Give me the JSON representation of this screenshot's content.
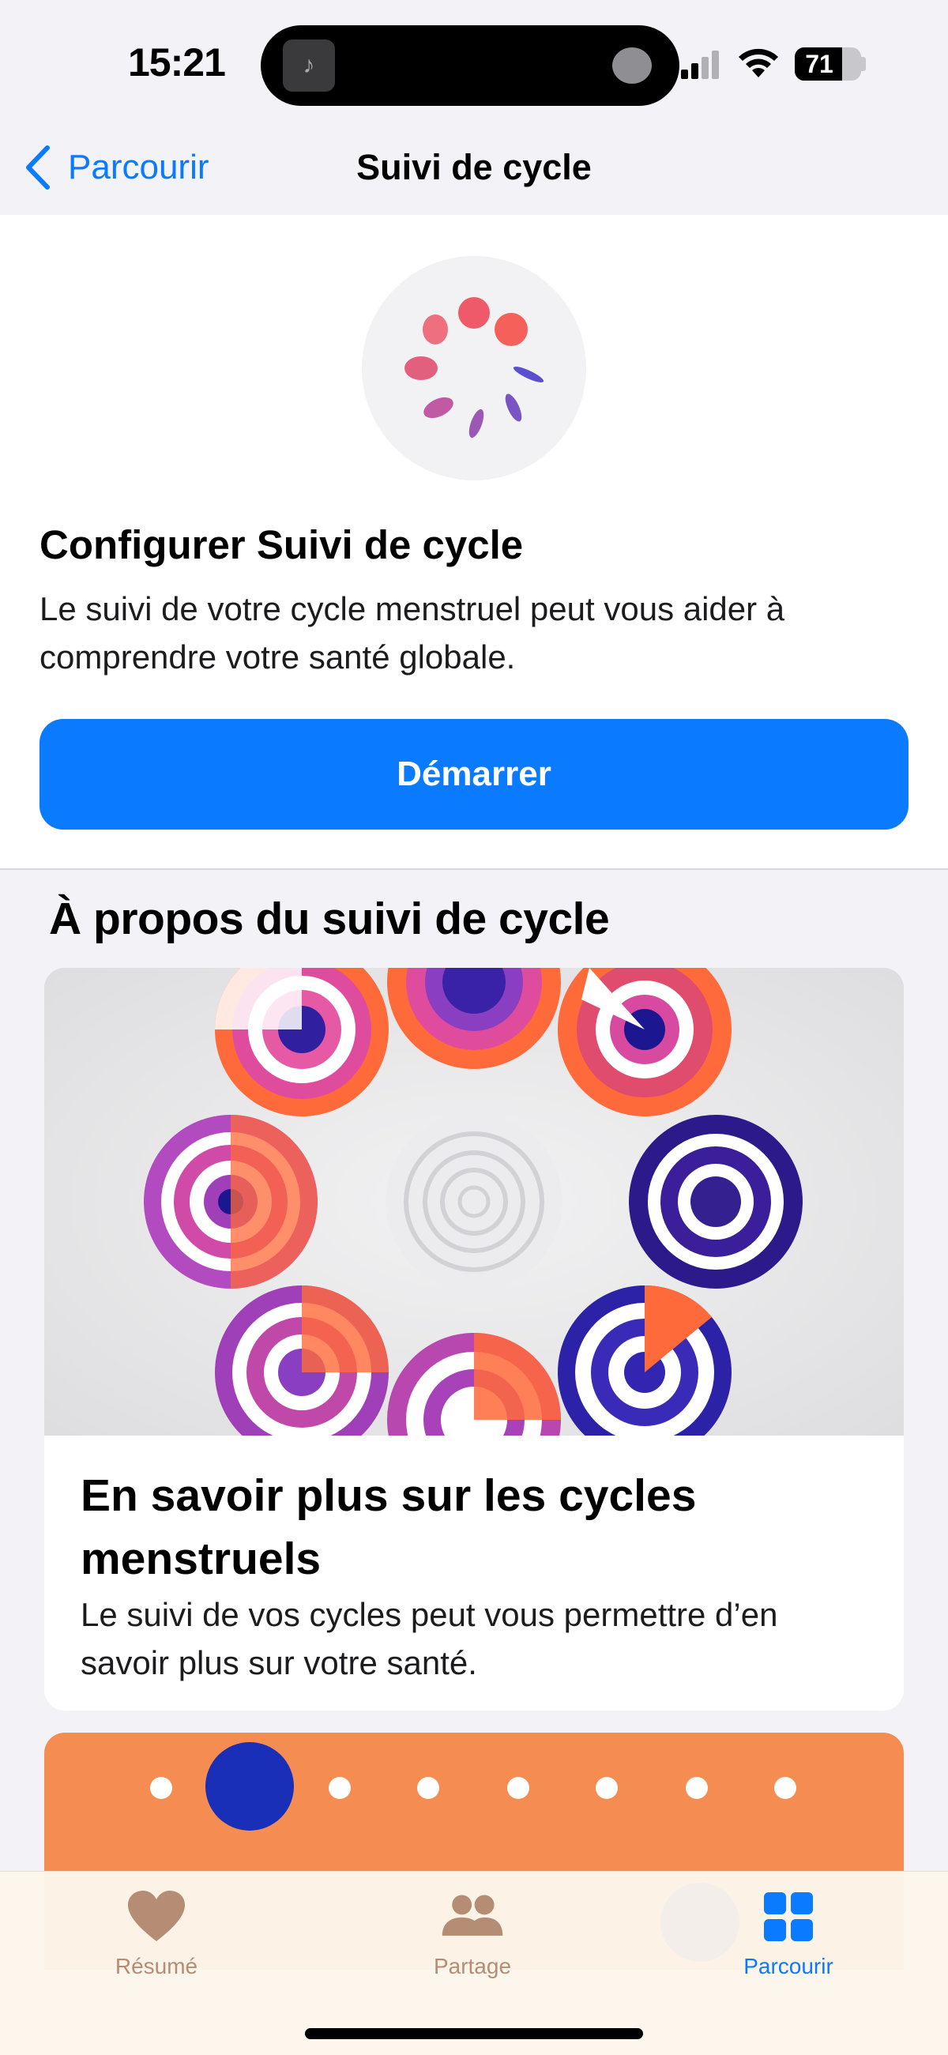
{
  "status_bar": {
    "time": "15:21",
    "battery_level": "71",
    "battery_fraction": 0.71,
    "icons": [
      "music-note-icon",
      "signal-icon",
      "wifi-icon",
      "battery-icon"
    ]
  },
  "nav": {
    "back_label": "Parcourir",
    "title": "Suivi de cycle"
  },
  "setup": {
    "title": "Configurer Suivi de cycle",
    "description": "Le suivi de votre cycle menstruel peut vous aider à comprendre votre santé globale.",
    "button_label": "Démarrer"
  },
  "about": {
    "section_title": "À propos du suivi de cycle",
    "card": {
      "title": "En savoir plus sur les cycles menstruels",
      "description": "Le suivi de vos cycles peut vous permettre d’en savoir plus sur votre santé."
    }
  },
  "tabbar": {
    "items": [
      {
        "label": "Résumé",
        "icon": "heart-icon",
        "selected": false
      },
      {
        "label": "Partage",
        "icon": "people-icon",
        "selected": false
      },
      {
        "label": "Parcourir",
        "icon": "grid-icon",
        "selected": true
      }
    ]
  },
  "colors": {
    "accent": "#0a7aff",
    "tab_inactive": "#b58c74",
    "orange_card": "#f58c52"
  }
}
